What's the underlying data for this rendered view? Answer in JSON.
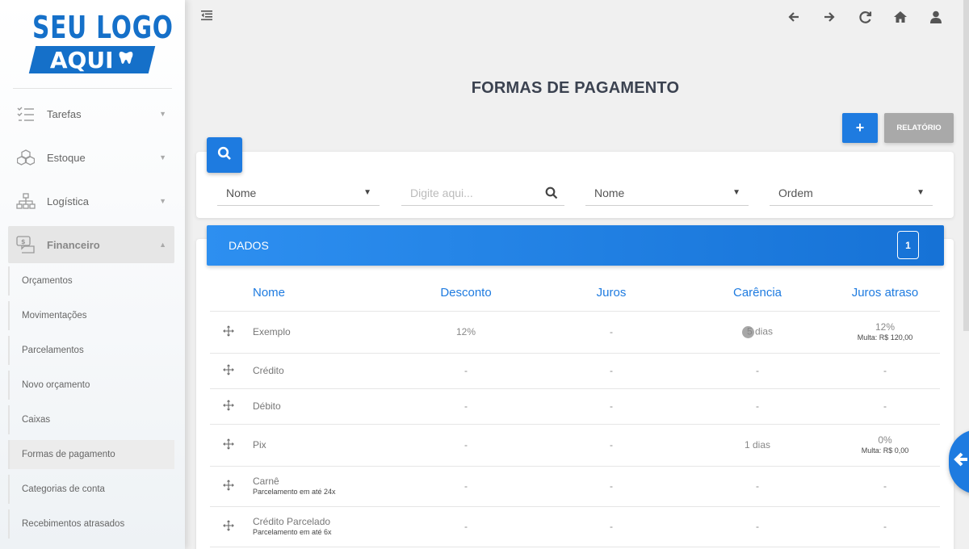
{
  "logo": {
    "line1": "SEU LOGO",
    "line2": "AQUI"
  },
  "sidebar": {
    "items": [
      {
        "label": "Tarefas",
        "icon": "tasks-icon"
      },
      {
        "label": "Estoque",
        "icon": "boxes-icon"
      },
      {
        "label": "Logística",
        "icon": "sitemap-icon"
      },
      {
        "label": "Financeiro",
        "icon": "money-icon"
      }
    ],
    "submenu": [
      "Orçamentos",
      "Movimentações",
      "Parcelamentos",
      "Novo orçamento",
      "Caixas",
      "Formas de pagamento",
      "Categorias de conta",
      "Recebimentos atrasados"
    ]
  },
  "page": {
    "title": "FORMAS DE PAGAMENTO"
  },
  "toolbar": {
    "add_label": "+",
    "report_label": "RELATÓRIO"
  },
  "filters": {
    "field1": "Nome",
    "search_placeholder": "Digite aqui...",
    "field3": "Nome",
    "field4": "Ordem"
  },
  "data": {
    "title": "DADOS",
    "count": "1",
    "columns": [
      "Nome",
      "Desconto",
      "Juros",
      "Carência",
      "Juros atraso"
    ],
    "rows": [
      {
        "nome": "Exemplo",
        "nome_sub": "",
        "desconto": "12%",
        "juros": "-",
        "carencia": "5 dias",
        "ja": "12%",
        "ja_sub": "Multa: R$ 120,00"
      },
      {
        "nome": "Crédito",
        "nome_sub": "",
        "desconto": "-",
        "juros": "-",
        "carencia": "-",
        "ja": "-",
        "ja_sub": ""
      },
      {
        "nome": "Débito",
        "nome_sub": "",
        "desconto": "-",
        "juros": "-",
        "carencia": "-",
        "ja": "-",
        "ja_sub": ""
      },
      {
        "nome": "Pix",
        "nome_sub": "",
        "desconto": "-",
        "juros": "-",
        "carencia": "1 dias",
        "ja": "0%",
        "ja_sub": "Multa: R$ 0,00"
      },
      {
        "nome": "Carnê",
        "nome_sub": "Parcelamento em até 24x",
        "desconto": "-",
        "juros": "-",
        "carencia": "-",
        "ja": "-",
        "ja_sub": ""
      },
      {
        "nome": "Crédito Parcelado",
        "nome_sub": "Parcelamento em até 6x",
        "desconto": "-",
        "juros": "-",
        "carencia": "-",
        "ja": "-",
        "ja_sub": ""
      }
    ]
  },
  "colors": {
    "primary": "#1e7be0",
    "title": "#3b4250",
    "grey_button": "#a9a9a9"
  }
}
